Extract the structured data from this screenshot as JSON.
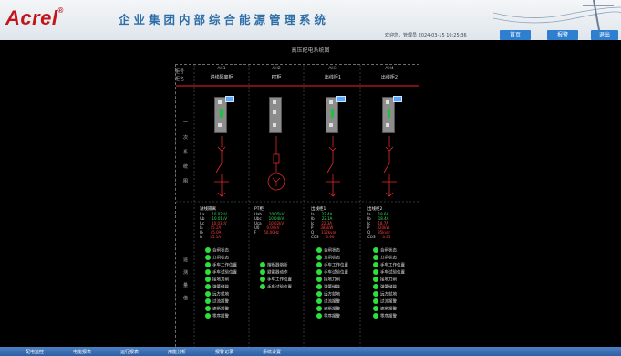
{
  "header": {
    "logo": "Acrel",
    "title": "企业集团内部综合能源管理系统",
    "user": "欢迎您，管理员  2024-03-15 10:25:36",
    "nav": [
      {
        "label": "首页",
        "color": "#2f7fd1"
      },
      {
        "label": "报警",
        "color": "#2f7fd1"
      },
      {
        "label": "退出",
        "color": "#2f7fd1"
      }
    ]
  },
  "page_title": "高压配电系统图",
  "row_labels": {
    "cabinet_no": "柜号",
    "cabinet_name": "柜名"
  },
  "side_chars_top": [
    "一",
    "次",
    "系",
    "统",
    "图"
  ],
  "side_chars_bottom": [
    "遥",
    "测",
    "量",
    "值"
  ],
  "columns": [
    {
      "number": "AH1",
      "name": "进线隔离柜",
      "meas_title": "进线隔离",
      "meas": [
        {
          "label": "Ua",
          "value": "10.02kV"
        },
        {
          "label": "Ub",
          "value": "10.01kV"
        },
        {
          "label": "Uc",
          "value": "10.03kV"
        },
        {
          "label": "Ia",
          "value": "45.2A"
        },
        {
          "label": "Ib",
          "value": "45.0A"
        },
        {
          "label": "Ic",
          "value": "45.1A"
        }
      ],
      "statuses": [
        "合闸状态",
        "分闸状态",
        "手车工作位置",
        "手车试验位置",
        "接地刀闸",
        "弹簧储能",
        "远方就地",
        "过流报警",
        "速断报警",
        "零序报警"
      ]
    },
    {
      "number": "AH2",
      "name": "PT柜",
      "meas_title": "PT柜",
      "meas": [
        {
          "label": "Uab",
          "value": "10.05kV"
        },
        {
          "label": "Ubc",
          "value": "10.04kV"
        },
        {
          "label": "Uca",
          "value": "10.02kV"
        },
        {
          "label": "U0",
          "value": "0.00kV"
        },
        {
          "label": "F",
          "value": "50.00Hz"
        },
        {
          "label": "",
          "value": ""
        }
      ],
      "statuses": [
        "熔断器熔断",
        "避雷器动作",
        "手车工作位置",
        "手车试验位置"
      ]
    },
    {
      "number": "AH3",
      "name": "出线柜1",
      "meas_title": "出线柜1",
      "meas": [
        {
          "label": "Ia",
          "value": "22.4A"
        },
        {
          "label": "Ib",
          "value": "22.1A"
        },
        {
          "label": "Ic",
          "value": "22.3A"
        },
        {
          "label": "P",
          "value": "385kW"
        },
        {
          "label": "Q",
          "value": "112kvar"
        },
        {
          "label": "COS",
          "value": "0.96"
        }
      ],
      "statuses": [
        "合闸状态",
        "分闸状态",
        "手车工作位置",
        "手车试验位置",
        "接地刀闸",
        "弹簧储能",
        "远方就地",
        "过流报警",
        "速断报警",
        "零序报警"
      ]
    },
    {
      "number": "AH4",
      "name": "出线柜2",
      "meas_title": "出线柜2",
      "meas": [
        {
          "label": "Ia",
          "value": "18.6A"
        },
        {
          "label": "Ib",
          "value": "18.4A"
        },
        {
          "label": "Ic",
          "value": "18.7A"
        },
        {
          "label": "P",
          "value": "320kW"
        },
        {
          "label": "Q",
          "value": "95kvar"
        },
        {
          "label": "COS",
          "value": "0.95"
        }
      ],
      "statuses": [
        "合闸状态",
        "分闸状态",
        "手车工作位置",
        "手车试验位置",
        "接地刀闸",
        "弹簧储能",
        "远方就地",
        "过流报警",
        "速断报警",
        "零序报警"
      ]
    }
  ],
  "taskbar": [
    "配电监控",
    "电能报表",
    "运行报表",
    "用能分析",
    "报警记录",
    "系统设置"
  ]
}
